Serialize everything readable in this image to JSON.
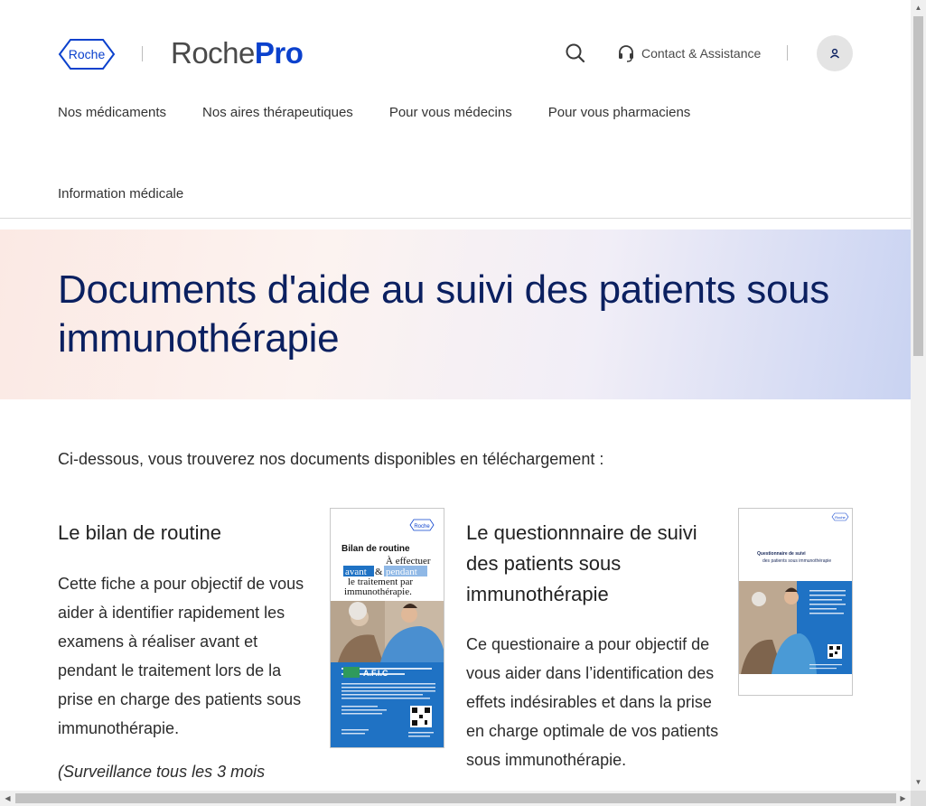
{
  "header": {
    "roche_logo_text": "Roche",
    "brand_prefix": "Roche",
    "brand_suffix": "Pro",
    "contact_label": "Contact & Assistance"
  },
  "nav": {
    "items": [
      "Nos médicaments",
      "Nos aires thérapeutiques",
      "Pour vous médecins",
      "Pour vous pharmaciens"
    ],
    "second_row": "Information médicale"
  },
  "hero": {
    "title": "Documents d'aide au suivi des patients sous immunothérapie"
  },
  "intro": "Ci-dessous, vous trouverez nos documents disponibles en téléchargement :",
  "documents": [
    {
      "title": "Le bilan de routine",
      "description": "Cette fiche a pour objectif de vous aider à identifier rapidement les examens à réaliser avant et pendant le traitement lors de la prise en charge des patients sous immunothérapie.",
      "note": "(Surveillance tous les 3 mois",
      "thumbnail": {
        "logo": "Roche",
        "title": "Bilan de routine",
        "line1": "À effectuer",
        "word_before": "avant",
        "amp": "&",
        "word_during": "pendant",
        "line2": "le traitement par",
        "line3": "immunothérapie.",
        "partner": "A.F.I.C"
      }
    },
    {
      "title": "Le questionnnaire de suivi des patients sous immunothérapie",
      "description": "Ce questionaire a pour objectif de vous aider dans l’identification des effets indésirables et dans la prise en charge optimale de vos patients sous immunothérapie.",
      "thumbnail": {
        "logo": "Roche",
        "title": "Questionnaire de suivi",
        "subtitle": "des patients sous immunothérapie"
      }
    }
  ],
  "colors": {
    "brand_blue": "#0b41cd",
    "title_navy": "#0b2060",
    "thumb_blue": "#1f72c4"
  }
}
